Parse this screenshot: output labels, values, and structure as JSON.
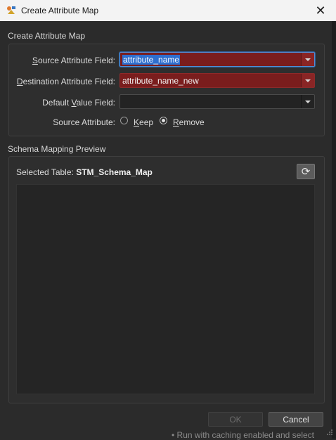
{
  "window": {
    "title": "Create Attribute Map"
  },
  "mapping_group": {
    "title": "Create Attribute Map",
    "source_label_ul": "S",
    "source_label_rest": "ource Attribute Field:",
    "source_value": "attribute_name",
    "dest_label_ul": "D",
    "dest_label_rest": "estination Attribute Field:",
    "dest_value": "attribute_name_new",
    "default_label_pre": "Default ",
    "default_label_ul": "V",
    "default_label_rest": "alue Field:",
    "default_value": "",
    "source_attr_label": "Source Attribute:",
    "keep_ul": "K",
    "keep_rest": "eep",
    "remove_ul": "R",
    "remove_rest": "emove",
    "selected_option": "Remove"
  },
  "preview_group": {
    "title": "Schema Mapping Preview",
    "selected_table_label": "Selected Table:",
    "selected_table_value": "STM_Schema_Map"
  },
  "buttons": {
    "ok": "OK",
    "cancel": "Cancel"
  },
  "background": {
    "partial_text": "• Run with caching enabled and select"
  },
  "colors": {
    "error_field": "#7a1d1d",
    "selection": "#2f6fcf",
    "dialog_bg": "#2b2b2b"
  }
}
